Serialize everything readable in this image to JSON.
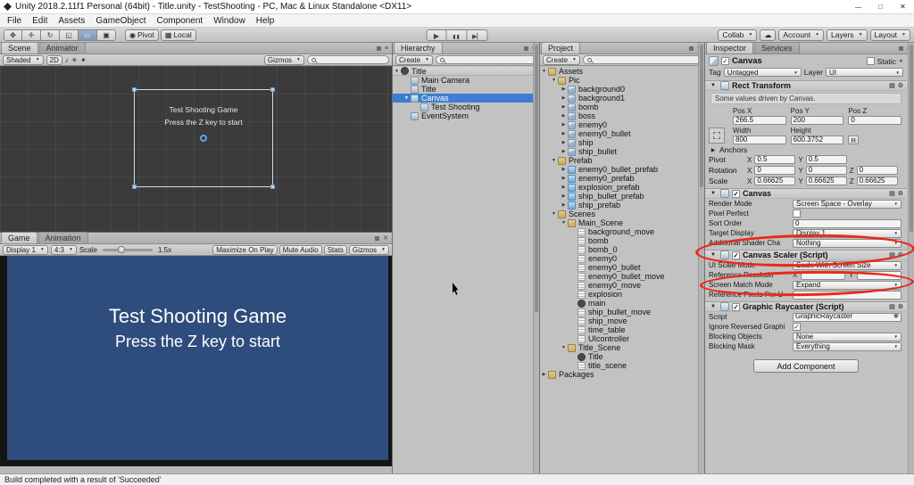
{
  "window": {
    "title": "Unity 2018.2.11f1 Personal (64bit) - Title.unity - TestShooting - PC, Mac & Linux Standalone <DX11>",
    "menu_items": [
      "File",
      "Edit",
      "Assets",
      "GameObject",
      "Component",
      "Window",
      "Help"
    ]
  },
  "toolbar": {
    "tools": [
      "hand-tool",
      "move-tool",
      "rotate-tool",
      "scale-tool",
      "rect-tool",
      "transform-tool"
    ],
    "active_tool": "rect-tool",
    "pivot_label": "Pivot",
    "local_label": "Local",
    "collab_label": "Collab",
    "account_label": "Account",
    "layers_label": "Layers",
    "layout_label": "Layout"
  },
  "scene_view": {
    "tabs": {
      "scene": "Scene",
      "animator": "Animator"
    },
    "shading_mode": "Shaded",
    "mode_2d_label": "2D",
    "gizmos_label": "Gizmos",
    "search_value": "",
    "overlay": {
      "line1": "Test Shooting Game",
      "line2": "Press the Z key to start"
    }
  },
  "game_view": {
    "tabs": {
      "game": "Game",
      "animation": "Animation"
    },
    "display": "Display 1",
    "aspect": "4:3",
    "scale_label": "Scale",
    "scale_value": "1.5x",
    "buttons": [
      "Maximize On Play",
      "Mute Audio",
      "Stats",
      "Gizmos"
    ],
    "overlay": {
      "line1": "Test Shooting Game",
      "line2": "Press the Z key to start"
    }
  },
  "hierarchy": {
    "tab": "Hierarchy",
    "create_label": "Create",
    "search_value": "",
    "items": [
      {
        "label": "Title",
        "indent": 0,
        "icon": "scene",
        "arrow": "down",
        "root": true
      },
      {
        "label": "Main Camera",
        "indent": 1,
        "icon": "gameobject"
      },
      {
        "label": "Title",
        "indent": 1,
        "icon": "gameobject"
      },
      {
        "label": "Canvas",
        "indent": 1,
        "icon": "gameobject",
        "arrow": "down",
        "selected": true
      },
      {
        "label": "Test Shooting",
        "indent": 2,
        "icon": "gameobject"
      },
      {
        "label": "EventSystem",
        "indent": 1,
        "icon": "gameobject"
      }
    ]
  },
  "project": {
    "tab": "Project",
    "create_label": "Create",
    "search_value": "",
    "items": [
      {
        "label": "Assets",
        "indent": 0,
        "icon": "folder",
        "arrow": "down"
      },
      {
        "label": "Pic",
        "indent": 1,
        "icon": "folder",
        "arrow": "down"
      },
      {
        "label": "background0",
        "indent": 2,
        "icon": "image",
        "arrow": "right"
      },
      {
        "label": "background1",
        "indent": 2,
        "icon": "image",
        "arrow": "right"
      },
      {
        "label": "bomb",
        "indent": 2,
        "icon": "image",
        "arrow": "right"
      },
      {
        "label": "boss",
        "indent": 2,
        "icon": "image",
        "arrow": "right"
      },
      {
        "label": "enemy0",
        "indent": 2,
        "icon": "image",
        "arrow": "right"
      },
      {
        "label": "enemy0_bullet",
        "indent": 2,
        "icon": "image",
        "arrow": "right"
      },
      {
        "label": "ship",
        "indent": 2,
        "icon": "image",
        "arrow": "right"
      },
      {
        "label": "ship_bullet",
        "indent": 2,
        "icon": "image",
        "arrow": "right"
      },
      {
        "label": "Prefab",
        "indent": 1,
        "icon": "folder",
        "arrow": "down"
      },
      {
        "label": "enemy0_bullet_prefab",
        "indent": 2,
        "icon": "prefab",
        "arrow": "right"
      },
      {
        "label": "enemy0_prefab",
        "indent": 2,
        "icon": "prefab",
        "arrow": "right"
      },
      {
        "label": "explosion_prefab",
        "indent": 2,
        "icon": "prefab",
        "arrow": "right"
      },
      {
        "label": "ship_bullet_prefab",
        "indent": 2,
        "icon": "prefab",
        "arrow": "right"
      },
      {
        "label": "ship_prefab",
        "indent": 2,
        "icon": "prefab",
        "arrow": "right"
      },
      {
        "label": "Scenes",
        "indent": 1,
        "icon": "folder",
        "arrow": "down"
      },
      {
        "label": "Main_Scene",
        "indent": 2,
        "icon": "folder",
        "arrow": "down"
      },
      {
        "label": "background_move",
        "indent": 3,
        "icon": "script"
      },
      {
        "label": "bomb",
        "indent": 3,
        "icon": "script"
      },
      {
        "label": "bomb_0",
        "indent": 3,
        "icon": "script"
      },
      {
        "label": "enemy0",
        "indent": 3,
        "icon": "script"
      },
      {
        "label": "enemy0_bullet",
        "indent": 3,
        "icon": "script"
      },
      {
        "label": "enemy0_bullet_move",
        "indent": 3,
        "icon": "script"
      },
      {
        "label": "enemy0_move",
        "indent": 3,
        "icon": "script"
      },
      {
        "label": "explosion",
        "indent": 3,
        "icon": "script"
      },
      {
        "label": "main",
        "indent": 3,
        "icon": "scene"
      },
      {
        "label": "ship_bullet_move",
        "indent": 3,
        "icon": "script"
      },
      {
        "label": "ship_move",
        "indent": 3,
        "icon": "script"
      },
      {
        "label": "time_table",
        "indent": 3,
        "icon": "script"
      },
      {
        "label": "UIcontroller",
        "indent": 3,
        "icon": "script"
      },
      {
        "label": "Title_Scene",
        "indent": 2,
        "icon": "folder",
        "arrow": "down"
      },
      {
        "label": "Title",
        "indent": 3,
        "icon": "scene"
      },
      {
        "label": "title_scene",
        "indent": 3,
        "icon": "script"
      },
      {
        "label": "Packages",
        "indent": 0,
        "icon": "folder",
        "arrow": "right"
      }
    ]
  },
  "inspector": {
    "tab_inspector": "Inspector",
    "tab_services": "Services",
    "header": {
      "name": "Canvas",
      "static_label": "Static",
      "tag_label": "Tag",
      "tag_value": "Untagged",
      "layer_label": "Layer",
      "layer_value": "UI"
    },
    "rect_transform": {
      "title": "Rect Transform",
      "note": "Some values driven by Canvas.",
      "pos_labels": [
        "Pos X",
        "Pos Y",
        "Pos Z"
      ],
      "pos_values": [
        "266.5",
        "200",
        "0"
      ],
      "size_labels": [
        "Width",
        "Height"
      ],
      "size_values": [
        "800",
        "600.3752"
      ],
      "blueprint_button": "R",
      "anchors_label": "Anchors",
      "vector_rows": [
        {
          "label": "Pivot",
          "axes": [
            "X",
            "Y"
          ],
          "values": [
            "0.5",
            "0.5"
          ]
        },
        {
          "label": "Rotation",
          "axes": [
            "X",
            "Y",
            "Z"
          ],
          "values": [
            "0",
            "0",
            "0"
          ]
        },
        {
          "label": "Scale",
          "axes": [
            "X",
            "Y",
            "Z"
          ],
          "values": [
            "0.66625",
            "0.66625",
            "0.66625"
          ]
        }
      ]
    },
    "components": [
      {
        "title": "Canvas",
        "checked": true,
        "rows": [
          {
            "label": "Render Mode",
            "control": "dropdown",
            "value": "Screen Space - Overlay"
          },
          {
            "label": "Pixel Perfect",
            "control": "checkbox",
            "checked": false
          },
          {
            "label": "Sort Order",
            "control": "input",
            "value": "0"
          },
          {
            "label": "Target Display",
            "control": "dropdown",
            "value": "Display 1"
          },
          {
            "label": "Additional Shader Cha",
            "control": "dropdown",
            "value": "Nothing"
          }
        ]
      },
      {
        "title": "Canvas Scaler (Script)",
        "checked": true,
        "rows": [
          {
            "label": "UI Scale Mode",
            "control": "dropdown",
            "value": "Scale With Screen Size"
          },
          {
            "label": "Reference Resolutio",
            "control": "vector2",
            "axes": [
              "X",
              "Y"
            ],
            "values": [
              "",
              ""
            ]
          },
          {
            "label": "Screen Match Mode",
            "control": "dropdown",
            "value": "Expand"
          },
          {
            "label": "Reference Pixels Per U",
            "control": "input",
            "value": ""
          }
        ]
      },
      {
        "title": "Graphic Raycaster (Script)",
        "checked": true,
        "rows": [
          {
            "label": "Script",
            "control": "object",
            "value": "GraphicRaycaster"
          },
          {
            "label": "Ignore Reversed Graphi",
            "control": "checkbox",
            "checked": true
          },
          {
            "label": "Blocking Objects",
            "control": "dropdown",
            "value": "None"
          },
          {
            "label": "Blocking Mask",
            "control": "dropdown",
            "value": "Everything"
          }
        ]
      }
    ],
    "add_component_label": "Add Component"
  },
  "status_bar": {
    "message": "Build completed with a result of 'Succeeded'"
  }
}
